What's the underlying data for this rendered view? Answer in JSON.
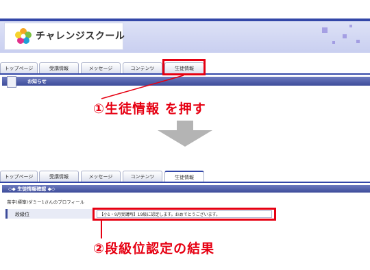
{
  "top": {
    "logo_text": "チャレンジスクール",
    "tabs": [
      "トップページ",
      "受講情報",
      "メッセージ",
      "コンテンツ",
      "生徒情報"
    ],
    "info_bar_label": "お知らせ"
  },
  "step1_label": "①生徒情報 を押す",
  "bottom": {
    "tabs": [
      "トップページ",
      "受講情報",
      "メッセージ",
      "コンテンツ",
      "生徒情報"
    ],
    "section_title": "◇◆ 生徒情報確認 ◆◇",
    "profile_line": "苗字(標簞)ダミー1さんのプロフィール",
    "row_label": "段級位",
    "row_value": "【小1・9月受講時】19級に認定します。おめでとうございます。"
  },
  "step2_label": "②段級位認定の結果",
  "colors": {
    "accent_red": "#e60012",
    "nav_blue": "#3347a8",
    "arrow_gray": "#b4b4b4"
  }
}
